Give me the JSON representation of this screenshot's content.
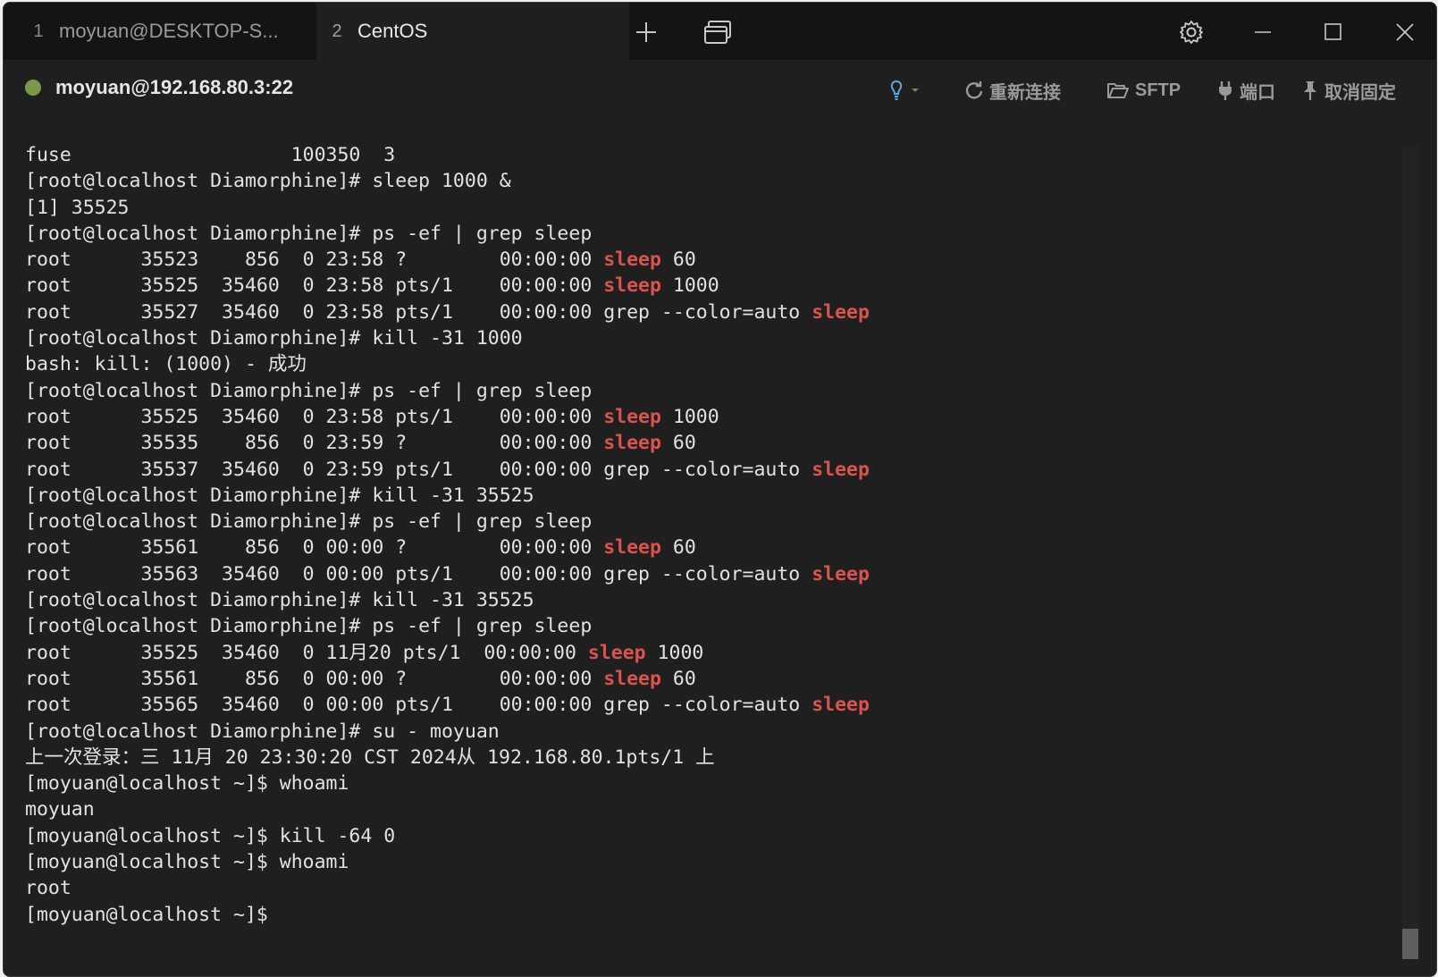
{
  "tabs": [
    {
      "num": "1",
      "label": "moyuan@DESKTOP-S..."
    },
    {
      "num": "2",
      "label": "CentOS"
    }
  ],
  "icons": {
    "new_tab": "plus-icon",
    "tab_overview": "windows-icon",
    "settings": "gear-icon",
    "minimize": "minimize-icon",
    "maximize": "maximize-icon",
    "close": "close-icon"
  },
  "connection": {
    "host": "moyuan@192.168.80.3:22",
    "status_color": "#7a9a4a"
  },
  "toolbar": {
    "hint_icon": "lightbulb-icon",
    "reconnect": "重新连接",
    "sftp": "SFTP",
    "port": "端口",
    "unpin": "取消固定"
  },
  "highlight_color": "#d9534f",
  "terminal": [
    [
      {
        "t": "fuse                   100350  3"
      }
    ],
    [
      {
        "t": "[root@localhost Diamorphine]# sleep 1000 &"
      }
    ],
    [
      {
        "t": "[1] 35525"
      }
    ],
    [
      {
        "t": "[root@localhost Diamorphine]# ps -ef | grep sleep"
      }
    ],
    [
      {
        "t": "root      35523    856  0 23:58 ?        00:00:00 "
      },
      {
        "t": "sleep",
        "hl": true
      },
      {
        "t": " 60"
      }
    ],
    [
      {
        "t": "root      35525  35460  0 23:58 pts/1    00:00:00 "
      },
      {
        "t": "sleep",
        "hl": true
      },
      {
        "t": " 1000"
      }
    ],
    [
      {
        "t": "root      35527  35460  0 23:58 pts/1    00:00:00 grep --color=auto "
      },
      {
        "t": "sleep",
        "hl": true
      }
    ],
    [
      {
        "t": "[root@localhost Diamorphine]# kill -31 1000"
      }
    ],
    [
      {
        "t": "bash: kill: (1000) - 成功"
      }
    ],
    [
      {
        "t": "[root@localhost Diamorphine]# ps -ef | grep sleep"
      }
    ],
    [
      {
        "t": "root      35525  35460  0 23:58 pts/1    00:00:00 "
      },
      {
        "t": "sleep",
        "hl": true
      },
      {
        "t": " 1000"
      }
    ],
    [
      {
        "t": "root      35535    856  0 23:59 ?        00:00:00 "
      },
      {
        "t": "sleep",
        "hl": true
      },
      {
        "t": " 60"
      }
    ],
    [
      {
        "t": "root      35537  35460  0 23:59 pts/1    00:00:00 grep --color=auto "
      },
      {
        "t": "sleep",
        "hl": true
      }
    ],
    [
      {
        "t": "[root@localhost Diamorphine]# kill -31 35525"
      }
    ],
    [
      {
        "t": "[root@localhost Diamorphine]# ps -ef | grep sleep"
      }
    ],
    [
      {
        "t": "root      35561    856  0 00:00 ?        00:00:00 "
      },
      {
        "t": "sleep",
        "hl": true
      },
      {
        "t": " 60"
      }
    ],
    [
      {
        "t": "root      35563  35460  0 00:00 pts/1    00:00:00 grep --color=auto "
      },
      {
        "t": "sleep",
        "hl": true
      }
    ],
    [
      {
        "t": "[root@localhost Diamorphine]# kill -31 35525"
      }
    ],
    [
      {
        "t": "[root@localhost Diamorphine]# ps -ef | grep sleep"
      }
    ],
    [
      {
        "t": "root      35525  35460  0 11月20 pts/1  00:00:00 "
      },
      {
        "t": "sleep",
        "hl": true
      },
      {
        "t": " 1000"
      }
    ],
    [
      {
        "t": "root      35561    856  0 00:00 ?        00:00:00 "
      },
      {
        "t": "sleep",
        "hl": true
      },
      {
        "t": " 60"
      }
    ],
    [
      {
        "t": "root      35565  35460  0 00:00 pts/1    00:00:00 grep --color=auto "
      },
      {
        "t": "sleep",
        "hl": true
      }
    ],
    [
      {
        "t": "[root@localhost Diamorphine]# su - moyuan"
      }
    ],
    [
      {
        "t": "上一次登录：三 11月 20 23:30:20 CST 2024从 192.168.80.1pts/1 上"
      }
    ],
    [
      {
        "t": "[moyuan@localhost ~]$ whoami"
      }
    ],
    [
      {
        "t": "moyuan"
      }
    ],
    [
      {
        "t": "[moyuan@localhost ~]$ kill -64 0"
      }
    ],
    [
      {
        "t": "[moyuan@localhost ~]$ whoami"
      }
    ],
    [
      {
        "t": "root"
      }
    ],
    [
      {
        "t": "[moyuan@localhost ~]$"
      }
    ]
  ]
}
